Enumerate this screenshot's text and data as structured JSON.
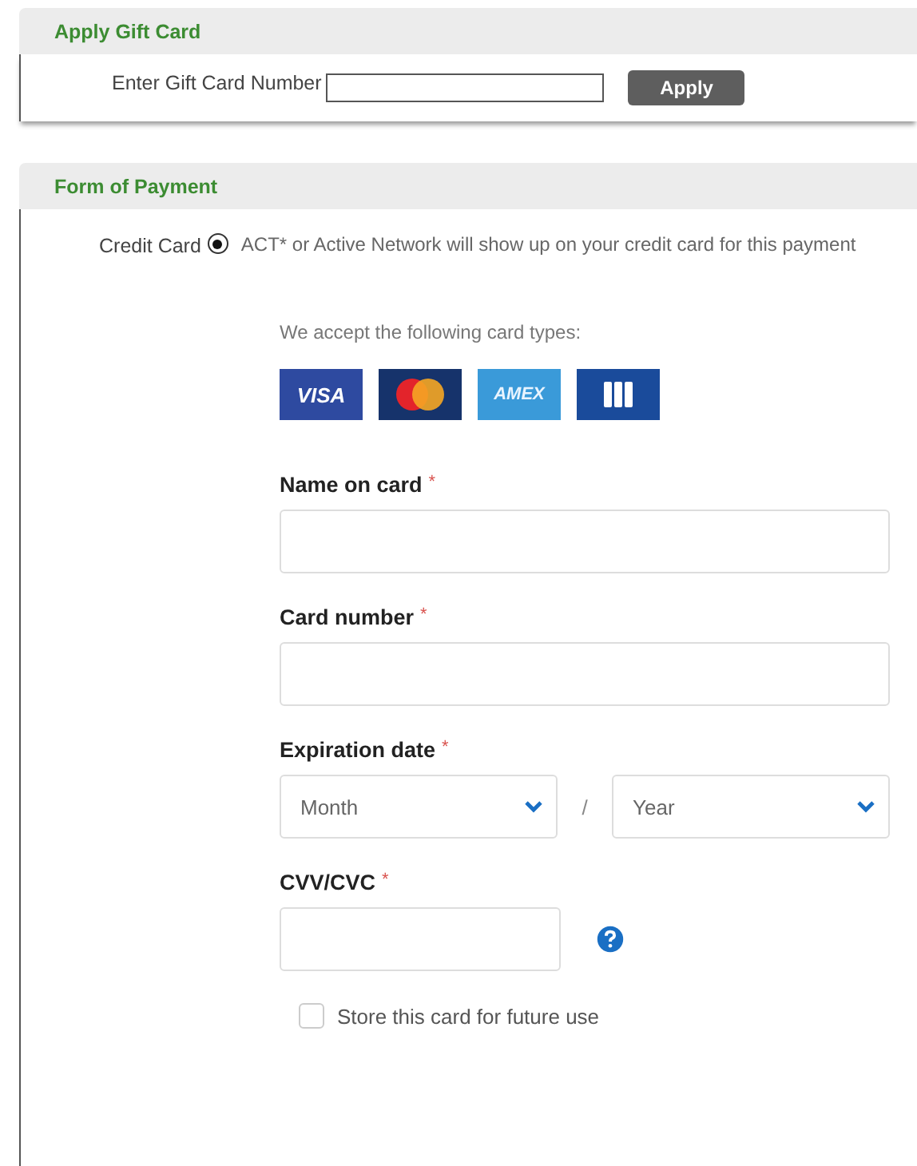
{
  "gift_card": {
    "title": "Apply Gift Card",
    "label": "Enter Gift Card Number",
    "button": "Apply"
  },
  "payment": {
    "title": "Form of Payment",
    "method": {
      "label": "Credit Card",
      "selected": true,
      "note": "ACT* or Active Network will show up on your credit card for this payment"
    },
    "accept_text": "We accept the following card types:",
    "cards": [
      {
        "kind": "visa",
        "label": "VISA"
      },
      {
        "kind": "mastercard"
      },
      {
        "kind": "amex",
        "label": "AMEX"
      },
      {
        "kind": "jcb"
      }
    ],
    "fields": [
      {
        "kind": "text",
        "label": "Name on card",
        "required_mark": "*"
      },
      {
        "kind": "text",
        "label": "Card number",
        "required_mark": "*"
      },
      {
        "kind": "expiry",
        "label": "Expiration date",
        "required_mark": "*",
        "month": "Month",
        "separator": "/",
        "year": "Year"
      },
      {
        "kind": "cvv",
        "label": "CVV/CVC",
        "required_mark": "*"
      }
    ],
    "store_card": {
      "label": "Store this card for future use",
      "checked": false
    }
  }
}
